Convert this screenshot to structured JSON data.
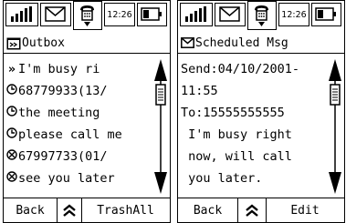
{
  "left": {
    "status": {
      "time": "12:26"
    },
    "title": "Outbox",
    "items": [
      {
        "icon": "sending-icon",
        "glyph": "»",
        "text": "I'm busy ri"
      },
      {
        "icon": "pending-clock-icon",
        "glyph": "",
        "text": "68779933(13/"
      },
      {
        "icon": "pending-clock-icon",
        "glyph": "",
        "text": "the meeting"
      },
      {
        "icon": "pending-clock-icon",
        "glyph": "",
        "text": "please call me"
      },
      {
        "icon": "failed-x-icon",
        "glyph": "",
        "text": "67997733(01/"
      },
      {
        "icon": "failed-x-icon",
        "glyph": "",
        "text": "see you later"
      }
    ],
    "softkeys": {
      "left": "Back",
      "right": "TrashAll"
    }
  },
  "right": {
    "status": {
      "time": "12:26"
    },
    "title": "Scheduled Msg",
    "lines": [
      "Send:04/10/2001-",
      "11:55",
      "To:15555555555",
      " I'm busy right",
      " now, will call",
      " you later."
    ],
    "softkeys": {
      "left": "Back",
      "right": "Edit"
    }
  }
}
